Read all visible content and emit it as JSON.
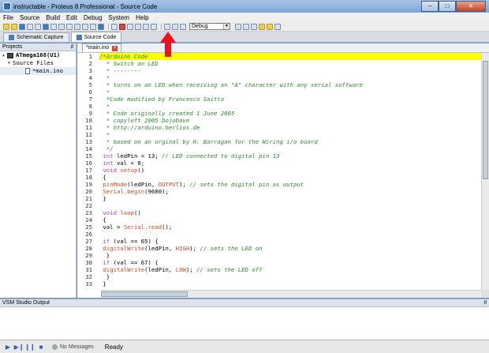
{
  "window": {
    "title": "instructable - Proteus 8 Professional - Source Code",
    "min_label": "–",
    "max_label": "□",
    "close_label": "✕"
  },
  "menu": [
    "File",
    "Source",
    "Build",
    "Edit",
    "Debug",
    "System",
    "Help"
  ],
  "toolbar": {
    "build_config": "Debug"
  },
  "tabs": [
    {
      "label": "Schematic Capture"
    },
    {
      "label": "Source Code"
    }
  ],
  "projects": {
    "header": "Projects",
    "pin": "♯",
    "device": "ATmega168(U1)",
    "folder": "Source Files",
    "file": "*main.ino"
  },
  "editor": {
    "doc_tab": "*main.ino",
    "doc_close": "×",
    "lines": [
      "/*Arduino Code",
      "  * Switch an LED",
      "  * --------",
      "  *",
      "  * turns on an LED when receiving an \"A\" character with any serial software",
      "  *",
      "  *Code modified by Francesco Saitta",
      "  *",
      "  * Code originally created 1 June 2005",
      "  * copyleft 2005 DojoDave",
      "  * http://arduino.berlios.de",
      "  *",
      "  * based on an orginal by H. Barragan for the Wiring i/o board",
      "  */",
      " int ledPin = 13; // LED connected to digital pin 13",
      " int val = 0;",
      " void setup()",
      " {",
      " pinMode(ledPin, OUTPUT); // sets the digital pin as output",
      " Serial.begin(9600);",
      " }",
      "",
      " void loop()",
      " {",
      " val = Serial.read();",
      "",
      " if (val == 65) {",
      " digitalWrite(ledPin, HIGH); // sets the LED on",
      "  }",
      " if (val == 67) {",
      " digitalWrite(ledPin, LOW); // sets the LED off",
      "  }",
      " }"
    ]
  },
  "output": {
    "header": "VSM Studio Output",
    "pin": "♯"
  },
  "status": {
    "messages": "No Messages",
    "state": "Ready"
  },
  "colors": {
    "highlight": "#ffff00",
    "arrow": "#e8141e"
  }
}
